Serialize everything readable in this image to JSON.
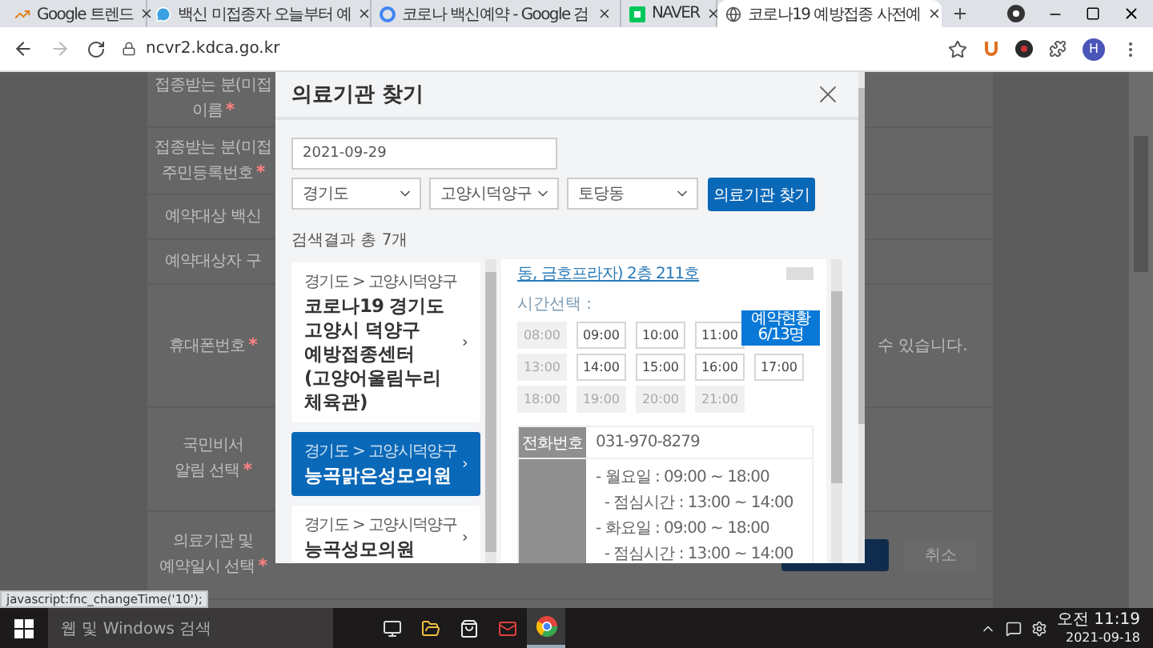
{
  "browser": {
    "tabs": [
      {
        "title": "Google 트렌드",
        "selected": false
      },
      {
        "title": "백신 미접종자 오늘부터 예",
        "selected": false
      },
      {
        "title": "코로나 백신예약 - Google 검",
        "selected": false
      },
      {
        "title": "NAVER",
        "selected": false
      },
      {
        "title": "코로나19 예방접종 사전예",
        "selected": true
      }
    ],
    "url": "ncvr2.kdca.go.kr",
    "profile_initial": "H"
  },
  "page": {
    "form_rows": [
      {
        "lines": [
          "접종받는 분(미접",
          "이름"
        ],
        "mark": "*"
      },
      {
        "lines": [
          "접종받는 분(미접",
          "주민등록번호"
        ],
        "mark": "*"
      },
      {
        "lines": [
          "예약대상 백신"
        ]
      },
      {
        "lines": [
          "예약대상자 구"
        ]
      },
      {
        "lines": [
          "휴대폰번호"
        ],
        "mark": "*",
        "notice": "수 있습니다."
      },
      {
        "lines": [
          "국민비서",
          "알림 선택"
        ],
        "mark": "*"
      },
      {
        "lines": [
          "의료기관 및",
          "예약일시 선택"
        ],
        "mark": "*",
        "cancel": "취소"
      }
    ]
  },
  "modal": {
    "title": "의료기관 찾기",
    "date": "2021-09-29",
    "selects": [
      "경기도",
      "고양시덕양구",
      "토당동"
    ],
    "search_button": "의료기관 찾기",
    "result_count": "검색결과 총 7개",
    "results": [
      {
        "breadcrumb": "경기도 > 고양시덕양구",
        "name": "코로나19 경기도 고양시 덕양구 예방접종센터(고양어울림누리 체육관)",
        "selected": false
      },
      {
        "breadcrumb": "경기도 > 고양시덕양구",
        "name": "능곡맑은성모의원",
        "selected": true
      },
      {
        "breadcrumb": "경기도 > 고양시덕양구",
        "name": "능곡성모의원",
        "selected": false
      }
    ],
    "detail": {
      "address": "동, 금호프라자) 2층 211호",
      "time_label": "시간선택 :",
      "time_rows": [
        [
          {
            "label": "08:00",
            "disabled": true
          },
          {
            "label": "09:00",
            "disabled": false
          },
          {
            "label": "10:00",
            "disabled": false
          },
          {
            "label": "11:00",
            "disabled": false
          }
        ],
        [
          {
            "label": "13:00",
            "disabled": true
          },
          {
            "label": "14:00",
            "disabled": false
          },
          {
            "label": "15:00",
            "disabled": false
          },
          {
            "label": "16:00",
            "disabled": false
          },
          {
            "label": "17:00",
            "disabled": false,
            "tooltip": [
              "예약현황",
              "6/13명"
            ]
          }
        ],
        [
          {
            "label": "18:00",
            "disabled": true
          },
          {
            "label": "19:00",
            "disabled": true
          },
          {
            "label": "20:00",
            "disabled": true
          },
          {
            "label": "21:00",
            "disabled": true
          }
        ]
      ],
      "info": [
        {
          "label": "전화번호",
          "lines": [
            "031-970-8279"
          ]
        },
        {
          "lines": [
            "- 월요일 : 09:00 ~ 18:00",
            "  - 점심시간 : 13:00 ~ 14:00",
            "- 화요일 : 09:00 ~ 18:00",
            "  - 점심시간 : 13:00 ~ 14:00"
          ]
        }
      ]
    }
  },
  "status_text": "javascript:fnc_changeTime('10');",
  "taskbar": {
    "search_placeholder": "웹 및 Windows 검색",
    "time": "오전 11:19",
    "date": "2021-09-18"
  }
}
